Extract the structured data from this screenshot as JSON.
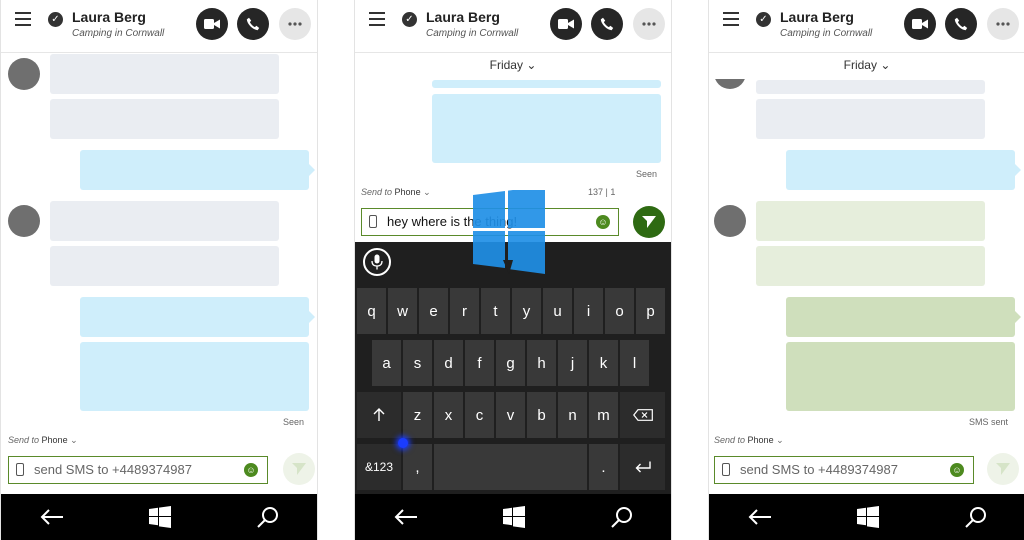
{
  "contact": {
    "name": "Laura Berg",
    "status": "Camping in Cornwall"
  },
  "colors": {
    "accent_green": "#2e6a12",
    "incoming_bubble": "#eaedf2",
    "outgoing_bubble": "#cfeefb",
    "sms_incoming": "#e6eedc",
    "sms_outgoing": "#cfdfbc"
  },
  "icons": [
    "menu-icon",
    "verified-icon",
    "video-call-icon",
    "call-icon",
    "more-icon",
    "phone-icon",
    "emoji-icon",
    "send-icon",
    "back-icon",
    "windows-icon",
    "search-icon",
    "microphone-icon",
    "shift-icon",
    "backspace-icon",
    "enter-icon"
  ],
  "screens": {
    "left": {
      "seen": "Seen",
      "send_to_prefix": "Send to",
      "send_to_target": "Phone",
      "input_placeholder": "send SMS to +4489374987"
    },
    "middle": {
      "day_label": "Friday",
      "seen": "Seen",
      "send_to_prefix": "Send to",
      "send_to_target": "Phone",
      "counter": "137 | 1",
      "input_value": "hey where is the thing!",
      "keyboard": {
        "row1": [
          "q",
          "w",
          "e",
          "r",
          "t",
          "y",
          "u",
          "i",
          "o",
          "p"
        ],
        "row2": [
          "a",
          "s",
          "d",
          "f",
          "g",
          "h",
          "j",
          "k",
          "l"
        ],
        "row3": [
          "z",
          "x",
          "c",
          "v",
          "b",
          "n",
          "m"
        ],
        "symbols_key": "&123",
        "comma_key": ",",
        "period_key": "."
      }
    },
    "right": {
      "day_label": "Friday",
      "sms_status": "SMS sent",
      "send_to_prefix": "Send to",
      "send_to_target": "Phone",
      "input_placeholder": "send SMS to +4489374987"
    }
  }
}
